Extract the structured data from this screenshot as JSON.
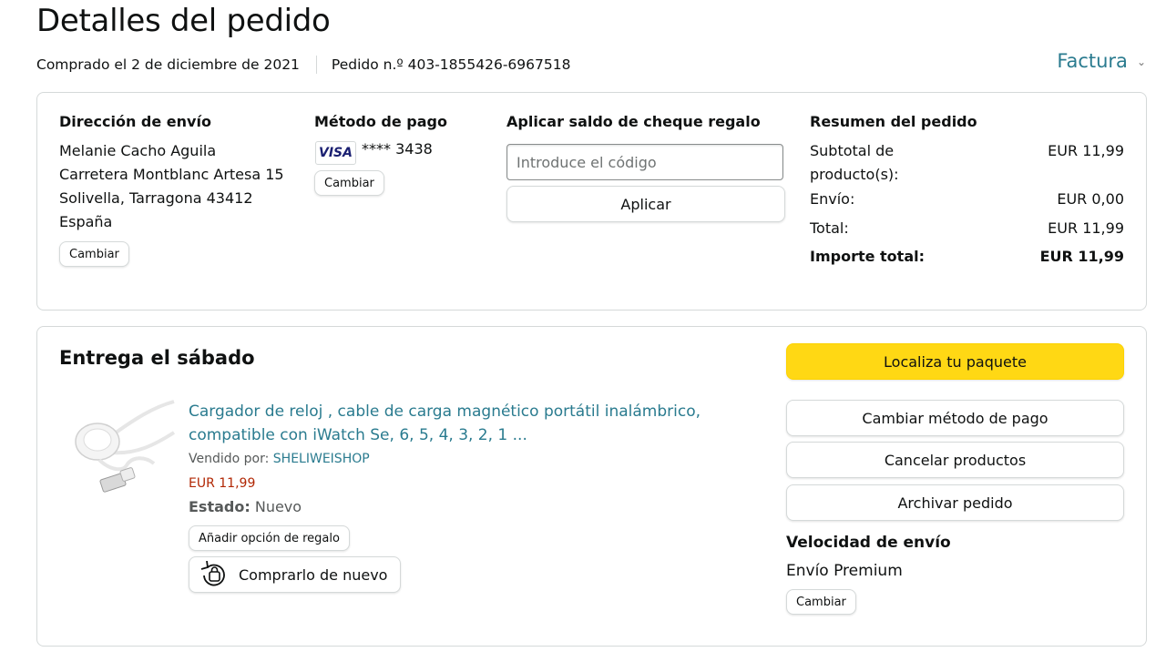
{
  "page_title": "Detalles del pedido",
  "order_meta": {
    "purchased": "Comprado el 2 de diciembre de 2021",
    "order_number": "Pedido n.º 403-1855426-6967518"
  },
  "invoice_label": "Factura",
  "shipping": {
    "heading": "Dirección de envío",
    "lines": [
      "Melanie Cacho Aguila",
      "Carretera Montblanc Artesa 15",
      "Solivella, Tarragona 43412",
      "España"
    ],
    "change_label": "Cambiar"
  },
  "payment": {
    "heading": "Método de pago",
    "card_brand": "VISA",
    "card_number": "**** 3438",
    "change_label": "Cambiar"
  },
  "gift": {
    "heading": "Aplicar saldo de cheque regalo",
    "placeholder": "Introduce el código",
    "apply_label": "Aplicar"
  },
  "summary": {
    "heading": "Resumen del pedido",
    "subtotal_label": "Subtotal de producto(s):",
    "subtotal_value": "EUR 11,99",
    "shipping_label": "Envío:",
    "shipping_value": "EUR 0,00",
    "total_label": "Total:",
    "total_value": "EUR 11,99",
    "grand_label": "Importe total:",
    "grand_value": "EUR 11,99"
  },
  "delivery": {
    "title": "Entrega el sábado",
    "product_title": "Cargador de reloj , cable de carga magnético portátil inalámbrico, compatible con iWatch Se, 6, 5, 4, 3, 2, 1 ...",
    "seller_label": "Vendido por:",
    "seller_name": "SHELIWEISHOP",
    "price": "EUR 11,99",
    "status_label": "Estado:",
    "status_value": "Nuevo",
    "gift_option_label": "Añadir opción de regalo",
    "buy_again_label": "Comprarlo de nuevo"
  },
  "actions": {
    "track_label": "Localiza tu paquete",
    "change_payment_label": "Cambiar método de pago",
    "cancel_label": "Cancelar productos",
    "archive_label": "Archivar pedido"
  },
  "shipping_speed": {
    "heading": "Velocidad de envío",
    "value": "Envío Premium",
    "change_label": "Cambiar"
  },
  "colors": {
    "link": "#2a7b8f",
    "price": "#b12704",
    "primary_button": "#ffd814",
    "border": "#d5d9d9"
  }
}
